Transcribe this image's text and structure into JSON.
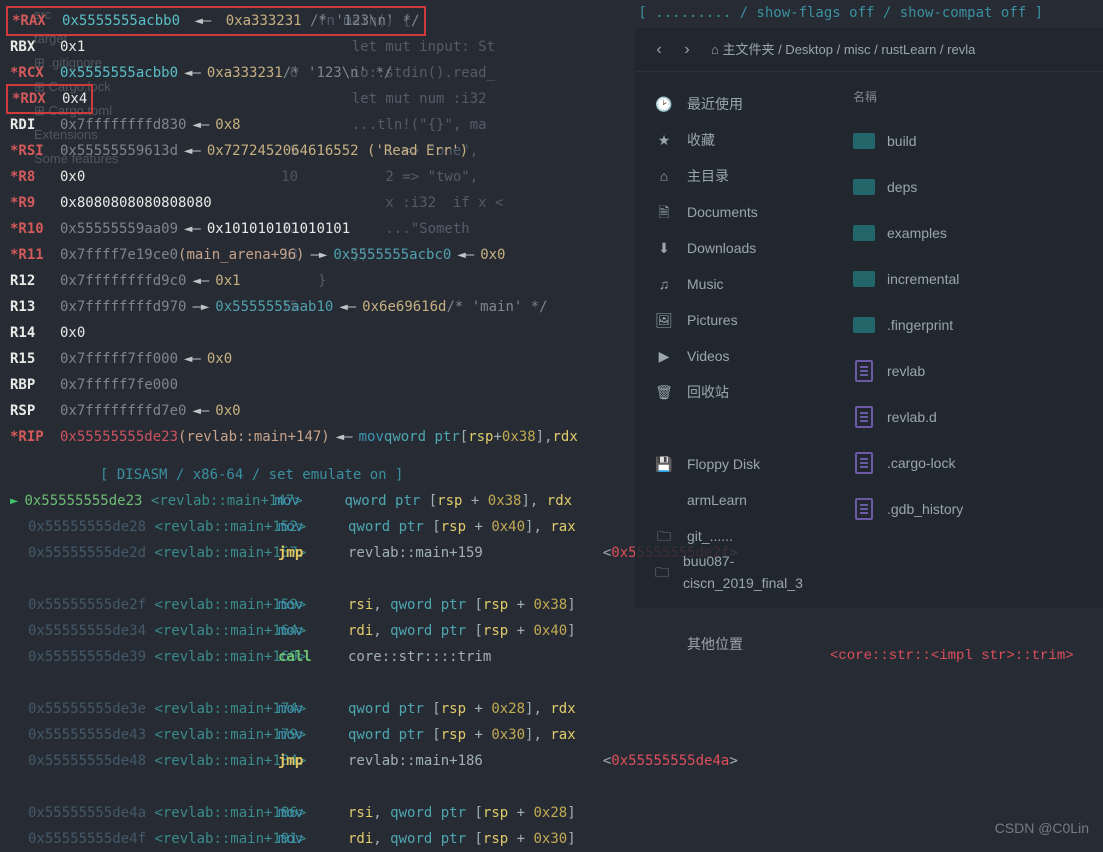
{
  "topnote": "[ ......... / show-flags off / show-compat off ]",
  "bg": {
    "lines": [
      {
        "n": "",
        "t": "fn main() {"
      },
      {
        "n": "",
        "t": "    let mut input: St"
      },
      {
        "n": "6",
        "t": "    io::stdin().read_"
      },
      {
        "n": "",
        "t": "    let mut num :i32"
      },
      {
        "n": "",
        "t": "    ...tln!(\"{}\", ma"
      },
      {
        "n": "9",
        "t": "        1 => \"one\","
      },
      {
        "n": "10",
        "t": "        2 => \"two\","
      },
      {
        "n": "",
        "t": "        x :i32  if x <"
      },
      {
        "n": "12",
        "t": "        ...\"Someth"
      },
      {
        "n": "13",
        "t": "    })"
      },
      {
        "n": "",
        "t": "}"
      },
      {
        "n": "15",
        "t": ""
      }
    ]
  },
  "side_ghost": [
    "src",
    "target",
    "⊞ .gitignore",
    "⊞ Cargo.lock",
    "⊞ Cargo.toml",
    "Extensions",
    "Some features"
  ],
  "regs": [
    {
      "l": "RAX",
      "c": true,
      "box": true,
      "v": "0x5555555acbb0",
      "arr": "◄—",
      "p": "0xa333231",
      "cm": "/* '123\\n' */",
      "pc": "gold2"
    },
    {
      "l": "RBX",
      "c": false,
      "v": "0x1",
      "vc": "white"
    },
    {
      "l": "RCX",
      "c": true,
      "v": "0x5555555acbb0",
      "vc": "cyan",
      "arr": "◄—",
      "p": "0xa333231",
      "cm": "/* '123\\n' */",
      "pc": "gold2"
    },
    {
      "l": "RDX",
      "c": true,
      "boxv": true,
      "v": "0x4",
      "vc": "white"
    },
    {
      "l": "RDI",
      "c": false,
      "v": "0x7ffffffffd830",
      "vc": "mute",
      "arr": "◄—",
      "p": "0x8",
      "pc": "gold2"
    },
    {
      "l": "RSI",
      "c": true,
      "v": "0x55555559613d",
      "vc": "mute",
      "arr": "◄—",
      "p": "0x7272452064616552 ('Read Err')",
      "pc": "gold2"
    },
    {
      "l": "R8",
      "c": true,
      "v": "0x0",
      "vc": "white"
    },
    {
      "l": "R9",
      "c": true,
      "v": "0x8080808080808080",
      "vc": "white"
    },
    {
      "l": "R10",
      "c": true,
      "v": "0x55555559aa09",
      "vc": "mute",
      "arr": "◄—",
      "p": "0x101010101010101",
      "pc": "white"
    },
    {
      "l": "R11",
      "c": true,
      "v": "0x7ffff7e19ce0",
      "vc": "mute",
      "ann": "(main_arena+96)",
      "arr": "—►",
      "p": "0x5555555acbc0",
      "pc": "dcyan",
      "arr2": "◄—",
      "p2": "0x0",
      "p2c": "gold2"
    },
    {
      "l": "R12",
      "c": false,
      "v": "0x7ffffffffd9c0",
      "vc": "mute",
      "arr": "◄—",
      "p": "0x1",
      "pc": "gold2"
    },
    {
      "l": "R13",
      "c": false,
      "v": "0x7ffffffffd970",
      "vc": "mute",
      "arr": "—►",
      "p": "0x5555555aab10",
      "pc": "dcyan",
      "arr2": "◄—",
      "p2": "0x6e69616d",
      "cm": "/* 'main' */",
      "p2c": "gold2"
    },
    {
      "l": "R14",
      "c": false,
      "v": "0x0",
      "vc": "white"
    },
    {
      "l": "R15",
      "c": false,
      "v": "0x7fffff7ff000",
      "vc": "mute",
      "arr": "◄—",
      "p": "0x0",
      "pc": "gold2"
    },
    {
      "l": "RBP",
      "c": false,
      "v": "0x7fffff7fe000",
      "vc": "mute"
    },
    {
      "l": "RSP",
      "c": false,
      "v": "0x7ffffffffd7e0",
      "vc": "mute",
      "arr": "◄—",
      "p": "0x0",
      "pc": "gold2"
    },
    {
      "l": "RIP",
      "c": true,
      "v": "0x55555555de23",
      "vc": "red",
      "ann": "(revlab::main+147)",
      "arr": "◄—",
      "rip": true
    }
  ],
  "rip_instr": {
    "op": "mov",
    "args": [
      [
        "ptr",
        "qword ptr"
      ],
      [
        "txt",
        ""
      ],
      [
        "txt",
        "["
      ],
      [
        "reg",
        "rsp"
      ],
      [
        "txt",
        " + "
      ],
      [
        "num",
        "0x38"
      ],
      [
        "txt",
        "], "
      ],
      [
        "reg",
        "rdx"
      ]
    ]
  },
  "dis_header": "[ DISASM / x86-64 / set emulate on ]",
  "dis": [
    {
      "cur": true,
      "a": "0x55555555de23",
      "o": "+147",
      "op": "mov",
      "t": "m1"
    },
    {
      "a": "0x55555555de28",
      "o": "+152",
      "op": "mov",
      "t": "m2"
    },
    {
      "a": "0x55555555de2d",
      "o": "+157",
      "op": "jmp",
      "jt": "revlab::main+159",
      "ta": "0x55555555de2f"
    },
    {
      "sp": true
    },
    {
      "a": "0x55555555de2f",
      "o": "+159",
      "op": "mov",
      "t": "r38"
    },
    {
      "a": "0x55555555de34",
      "o": "+164",
      "op": "mov",
      "t": "r40"
    },
    {
      "a": "0x55555555de39",
      "o": "+169",
      "op": "call",
      "ct": "core::str::<impl str>::trim"
    },
    {
      "sp": true
    },
    {
      "a": "0x55555555de3e",
      "o": "+174",
      "op": "mov",
      "t": "m28"
    },
    {
      "a": "0x55555555de43",
      "o": "+179",
      "op": "mov",
      "t": "m30"
    },
    {
      "a": "0x55555555de48",
      "o": "+184",
      "op": "jmp",
      "jt": "revlab::main+186",
      "ta": "0x55555555de4a"
    },
    {
      "sp": true
    },
    {
      "a": "0x55555555de4a",
      "o": "+186",
      "op": "mov",
      "t": "r28"
    },
    {
      "a": "0x55555555de4f",
      "o": "+191",
      "op": "mov",
      "t": "r30"
    }
  ],
  "operands": {
    "m1": [
      [
        "ptr",
        "qword ptr "
      ],
      [
        "txt",
        "["
      ],
      [
        "reg",
        "rsp"
      ],
      [
        "txt",
        " + "
      ],
      [
        "num",
        "0x38"
      ],
      [
        "txt",
        "], "
      ],
      [
        "reg",
        "rdx"
      ]
    ],
    "m2": [
      [
        "ptr",
        "qword ptr "
      ],
      [
        "txt",
        "["
      ],
      [
        "reg",
        "rsp"
      ],
      [
        "txt",
        " + "
      ],
      [
        "num",
        "0x40"
      ],
      [
        "txt",
        "], "
      ],
      [
        "reg",
        "rax"
      ]
    ],
    "r38": [
      [
        "reg",
        "rsi"
      ],
      [
        "txt",
        ", "
      ],
      [
        "ptr",
        "qword ptr "
      ],
      [
        "txt",
        "["
      ],
      [
        "reg",
        "rsp"
      ],
      [
        "txt",
        " + "
      ],
      [
        "num",
        "0x38"
      ],
      [
        "txt",
        "]"
      ]
    ],
    "r40": [
      [
        "reg",
        "rdi"
      ],
      [
        "txt",
        ", "
      ],
      [
        "ptr",
        "qword ptr "
      ],
      [
        "txt",
        "["
      ],
      [
        "reg",
        "rsp"
      ],
      [
        "txt",
        " + "
      ],
      [
        "num",
        "0x40"
      ],
      [
        "txt",
        "]"
      ]
    ],
    "m28": [
      [
        "ptr",
        "qword ptr "
      ],
      [
        "txt",
        "["
      ],
      [
        "reg",
        "rsp"
      ],
      [
        "txt",
        " + "
      ],
      [
        "num",
        "0x28"
      ],
      [
        "txt",
        "], "
      ],
      [
        "reg",
        "rdx"
      ]
    ],
    "m30": [
      [
        "ptr",
        "qword ptr "
      ],
      [
        "txt",
        "["
      ],
      [
        "reg",
        "rsp"
      ],
      [
        "txt",
        " + "
      ],
      [
        "num",
        "0x30"
      ],
      [
        "txt",
        "], "
      ],
      [
        "reg",
        "rax"
      ]
    ],
    "r28": [
      [
        "reg",
        "rsi"
      ],
      [
        "txt",
        ", "
      ],
      [
        "ptr",
        "qword ptr "
      ],
      [
        "txt",
        "["
      ],
      [
        "reg",
        "rsp"
      ],
      [
        "txt",
        " + "
      ],
      [
        "num",
        "0x28"
      ],
      [
        "txt",
        "]"
      ]
    ],
    "r30": [
      [
        "reg",
        "rdi"
      ],
      [
        "txt",
        ", "
      ],
      [
        "ptr",
        "qword ptr "
      ],
      [
        "txt",
        "["
      ],
      [
        "reg",
        "rsp"
      ],
      [
        "txt",
        " + "
      ],
      [
        "num",
        "0x30"
      ],
      [
        "txt",
        "]"
      ]
    ]
  },
  "far_call": "<core::str::<impl str>::trim>",
  "fm": {
    "nav": {
      "back": "‹",
      "fwd": "›"
    },
    "path": "⌂ 主文件夹 / Desktop / misc / rustLearn / revla",
    "hdr": "名稱",
    "side": [
      {
        "i": "🕑",
        "t": "最近使用"
      },
      {
        "i": "★",
        "t": "收藏"
      },
      {
        "i": "⌂",
        "t": "主目录"
      },
      {
        "i": "🗎",
        "t": "Documents"
      },
      {
        "i": "⬇",
        "t": "Downloads"
      },
      {
        "i": "♫",
        "t": "Music"
      },
      {
        "i": "🖼",
        "t": "Pictures"
      },
      {
        "i": "▶",
        "t": "Videos"
      },
      {
        "i": "🗑",
        "t": "回收站"
      },
      {
        "i": "",
        "t": ""
      },
      {
        "i": "💾",
        "t": "Floppy Disk"
      },
      {
        "i": "",
        "t": "armLearn"
      },
      {
        "i": "🗀",
        "t": "git_......"
      },
      {
        "i": "🗀",
        "t": "buu087-ciscn_2019_final_3"
      },
      {
        "i": "",
        "t": ""
      },
      {
        "i": "",
        "t": "其他位置"
      }
    ],
    "files": [
      {
        "k": "f",
        "t": "build"
      },
      {
        "k": "f",
        "t": "deps"
      },
      {
        "k": "f",
        "t": "examples"
      },
      {
        "k": "f",
        "t": "incremental"
      },
      {
        "k": "f",
        "t": ".fingerprint"
      },
      {
        "k": "d",
        "t": "revlab"
      },
      {
        "k": "d",
        "t": "revlab.d"
      },
      {
        "k": "d",
        "t": ".cargo-lock"
      },
      {
        "k": "d",
        "t": ".gdb_history"
      }
    ]
  },
  "watermark": "CSDN @C0Lin"
}
